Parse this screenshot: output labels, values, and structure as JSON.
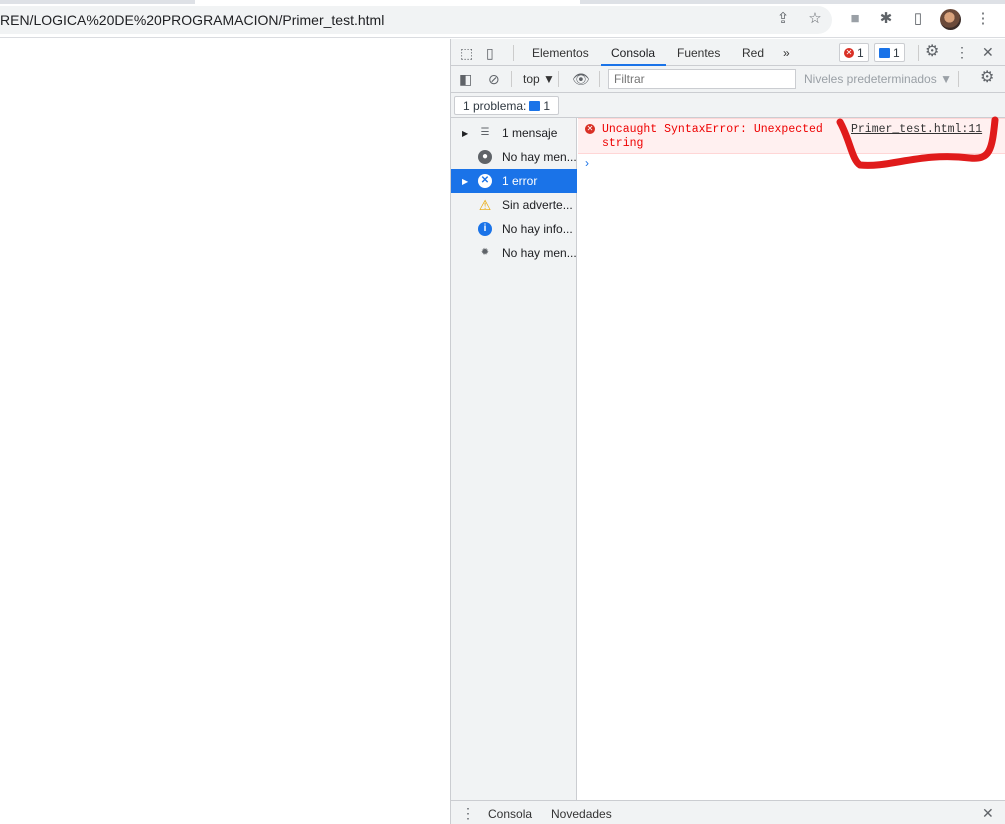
{
  "browser": {
    "url": "REN/LOGICA%20DE%20PROGRAMACION/Primer_test.html"
  },
  "devtools": {
    "tabs": [
      "Elementos",
      "Consola",
      "Fuentes",
      "Red"
    ],
    "more_tabs": "»",
    "error_count": "1",
    "message_count": "1",
    "context": "top ▼",
    "filter_placeholder": "Filtrar",
    "levels": "Niveles predeterminados ▼",
    "issues": {
      "label": "1 problema:",
      "count": "1"
    },
    "sidebar": [
      {
        "label": "1 mensaje",
        "icon": "list-icon",
        "expandable": true
      },
      {
        "label": "No hay men...",
        "icon": "user-icon"
      },
      {
        "label": "1 error",
        "icon": "error-icon",
        "expandable": true,
        "selected": true
      },
      {
        "label": "Sin adverte...",
        "icon": "warning-icon"
      },
      {
        "label": "No hay info...",
        "icon": "info-icon"
      },
      {
        "label": "No hay men...",
        "icon": "bug-icon"
      }
    ],
    "console": {
      "error_line1": "Uncaught SyntaxError: Unexpected",
      "error_line2": "string",
      "source_link": "Primer_test.html:11",
      "prompt": "›"
    },
    "drawer": {
      "tabs": [
        "Consola",
        "Novedades"
      ]
    }
  },
  "colors": {
    "accent": "#1a73e8",
    "error": "#e00000",
    "annotation": "#e01b1b"
  }
}
